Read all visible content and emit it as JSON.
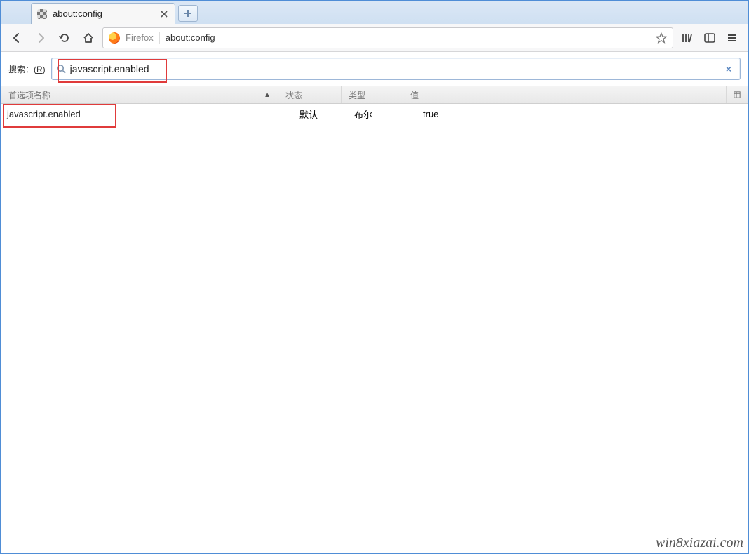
{
  "tab": {
    "title": "about:config"
  },
  "toolbar": {
    "firefox_word": "Firefox",
    "url": "about:config"
  },
  "search": {
    "label_prefix": "搜索：(",
    "label_hotkey": "R",
    "label_suffix": ")",
    "value": "javascript.enabled"
  },
  "columns": {
    "name": "首选项名称",
    "status": "状态",
    "type": "类型",
    "value": "值"
  },
  "rows": [
    {
      "name": "javascript.enabled",
      "status": "默认",
      "type": "布尔",
      "value": "true"
    }
  ],
  "watermark": "win8xiazai.com"
}
